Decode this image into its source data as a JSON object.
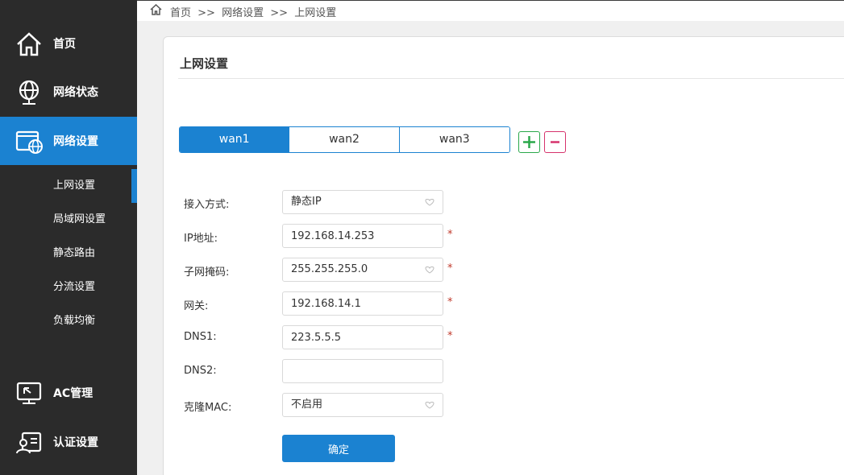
{
  "breadcrumb": {
    "home": "首页",
    "sep": ">>",
    "level2": "网络设置",
    "level3": "上网设置"
  },
  "sidebar": {
    "main": [
      {
        "label": "首页",
        "icon": "home-icon"
      },
      {
        "label": "网络状态",
        "icon": "globe-icon"
      },
      {
        "label": "网络设置",
        "icon": "network-settings-icon",
        "active": true
      },
      {
        "label": "AC管理",
        "icon": "monitor-icon"
      },
      {
        "label": "认证设置",
        "icon": "auth-icon"
      }
    ],
    "sub": [
      {
        "label": "上网设置",
        "current": true
      },
      {
        "label": "局域网设置"
      },
      {
        "label": "静态路由"
      },
      {
        "label": "分流设置"
      },
      {
        "label": "负载均衡"
      }
    ]
  },
  "panel": {
    "title": "上网设置"
  },
  "tabs": [
    {
      "label": "wan1",
      "active": true
    },
    {
      "label": "wan2"
    },
    {
      "label": "wan3"
    }
  ],
  "form": {
    "access_mode": {
      "label": "接入方式:",
      "value": "静态IP"
    },
    "ip": {
      "label": "IP地址:",
      "value": "192.168.14.253",
      "required": "*"
    },
    "mask": {
      "label": "子网掩码:",
      "value": "255.255.255.0",
      "required": "*"
    },
    "gateway": {
      "label": "网关:",
      "value": "192.168.14.1",
      "required": "*"
    },
    "dns1": {
      "label": "DNS1:",
      "value": "223.5.5.5",
      "required": "*"
    },
    "dns2": {
      "label": "DNS2:",
      "value": ""
    },
    "clone_mac": {
      "label": "克隆MAC:",
      "value": "不启用"
    },
    "submit_label": "确定"
  },
  "colors": {
    "accent": "#1b82d1",
    "sidebar": "#2b2b2b",
    "add": "#2aa84a",
    "remove": "#d6336c",
    "required": "#c0392b"
  }
}
